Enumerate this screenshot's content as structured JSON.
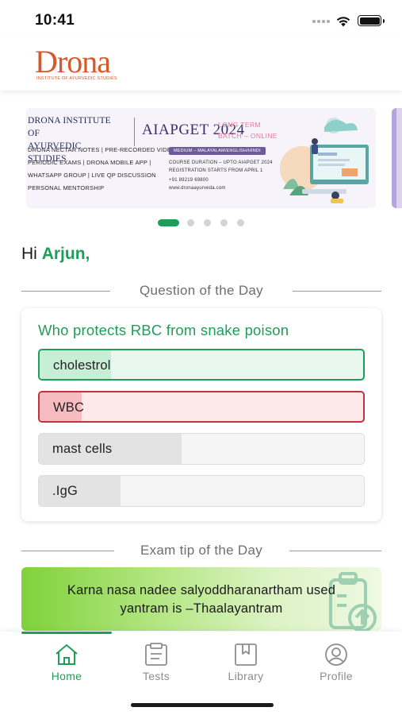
{
  "status_bar": {
    "time": "10:41"
  },
  "header": {
    "logo_icon": "drona-logo",
    "logo_text": "Drona",
    "logo_subtitle": "INSTITUTE OF AYURVEDIC STUDIES"
  },
  "banner": {
    "institute_line1": "DRONA INSTITUTE OF",
    "institute_line2": "AYURVEDIC STUDIES",
    "title": "AIAPGET 2024",
    "batch_line1": "LONG TERM",
    "batch_line2": "BATCH – ONLINE",
    "features": [
      "DRONA NECTAR NOTES | PRE-RECORDED VIDEOS",
      "PERIODIC EXAMS | DRONA MOBILE APP |",
      "WHATSAPP GROUP | LIVE QP DISCUSSION",
      "PERSONAL MENTORSHIP"
    ],
    "medium": "MEDIUM – MALAYALAM/ENGLISH/HINDI",
    "duration": "COURSE DURATION – UPTO AIAPGET 2024",
    "registration": "REGISTRATION STARTS FROM APRIL 1",
    "phone": "+91 89219 69800",
    "website": "www.dronaayurveda.com",
    "slide_count": 5,
    "active_slide": 1
  },
  "greeting": {
    "prefix": "Hi",
    "name": "Arjun,"
  },
  "question_section": {
    "title": "Question of the Day",
    "question": "Who protects RBC from snake poison",
    "options": [
      {
        "label": "cholestrol",
        "state": "correct",
        "share": 0.22
      },
      {
        "label": "WBC",
        "state": "wrong",
        "share": 0.13
      },
      {
        "label": "mast cells",
        "state": "neutral",
        "share": 0.44
      },
      {
        "label": ".IgG",
        "state": "neutral",
        "share": 0.25
      }
    ]
  },
  "tip_section": {
    "title": "Exam tip of the Day",
    "line1": "Karna nasa nadee salyoddharanartham used",
    "line2": "yantram is –Thaalayantram",
    "icon": "document-upload-icon"
  },
  "tabs": [
    {
      "label": "Home",
      "icon": "home-icon",
      "active": true
    },
    {
      "label": "Tests",
      "icon": "tests-clipboard-icon",
      "active": false
    },
    {
      "label": "Library",
      "icon": "library-bookmark-icon",
      "active": false
    },
    {
      "label": "Profile",
      "icon": "profile-user-icon",
      "active": false
    }
  ],
  "colors": {
    "brand_green": "#1e9e58",
    "wrong_red": "#c0353d",
    "logo_orange": "#d9582a",
    "tab_inactive": "#8d8d8d"
  }
}
